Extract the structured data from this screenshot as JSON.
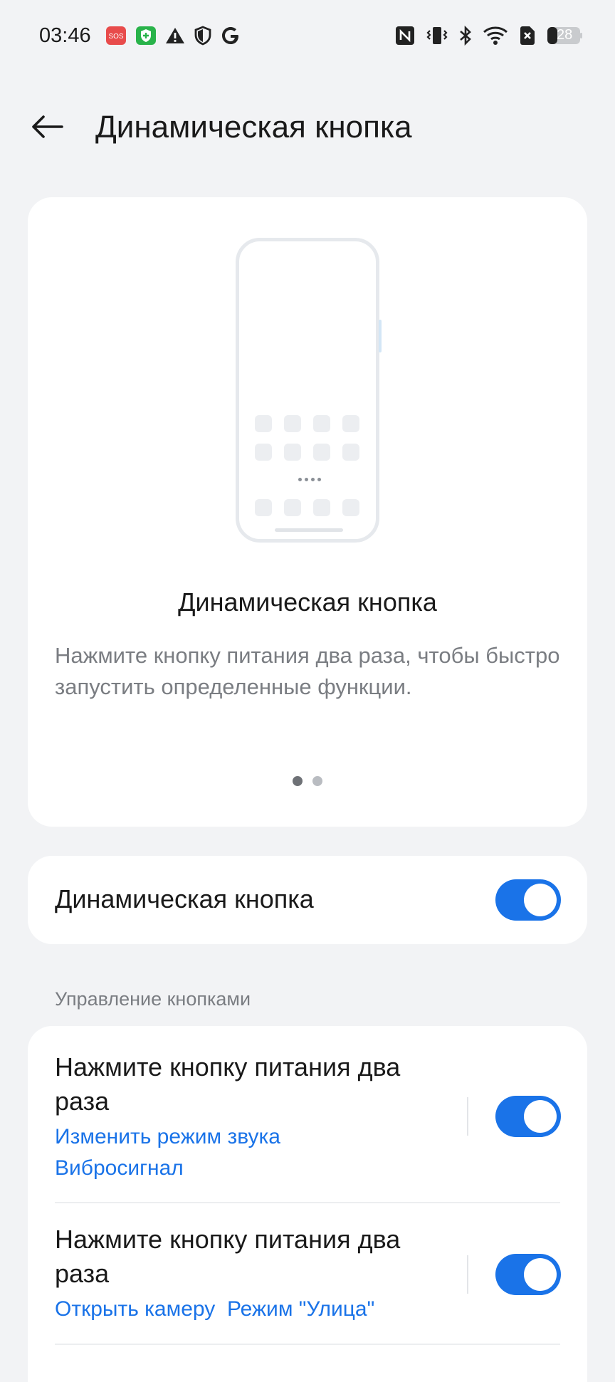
{
  "status_bar": {
    "time": "03:46",
    "sos_badge": "SOS",
    "battery_level": "28",
    "icons": [
      "sos-icon",
      "shield-plus-icon",
      "warning-icon",
      "shield-icon",
      "google-icon",
      "nfc-icon",
      "vibrate-icon",
      "bluetooth-icon",
      "wifi-icon",
      "no-sim-icon",
      "battery-icon"
    ]
  },
  "header": {
    "title": "Динамическая кнопка"
  },
  "hero": {
    "title": "Динамическая кнопка",
    "description": "Нажмите кнопку питания два раза, чтобы быстро запустить определенные функции.",
    "pages": 2,
    "active_page": 1
  },
  "main_toggle": {
    "label": "Динамическая кнопка",
    "enabled": true
  },
  "section": {
    "label": "Управление кнопками"
  },
  "items": [
    {
      "title": "Нажмите кнопку питания два раза",
      "sub1": "Изменить режим звука",
      "sub2": "Вибросигнал",
      "enabled": true
    },
    {
      "title": "Нажмите кнопку питания два раза",
      "sub1": "Открыть камеру  Режим \"Улица\"",
      "enabled": true
    }
  ],
  "colors": {
    "accent": "#1a73e8",
    "background": "#f2f3f5",
    "card": "#ffffff",
    "secondary_text": "#7a7d82"
  }
}
